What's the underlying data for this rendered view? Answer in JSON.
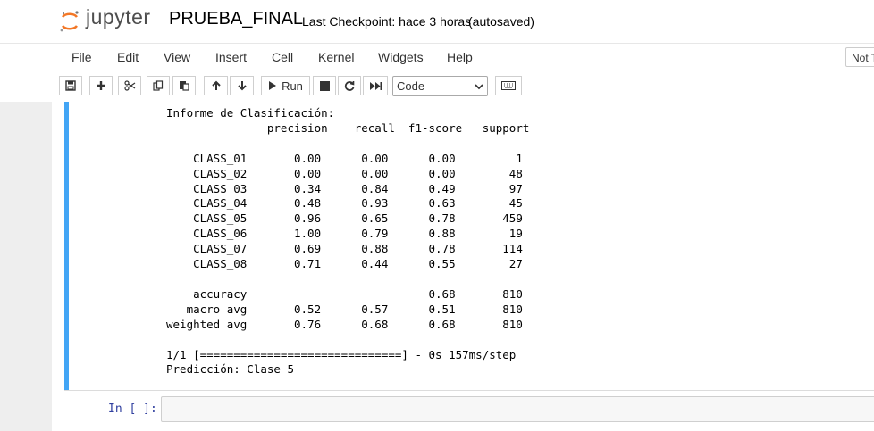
{
  "header": {
    "logo_text": "jupyter",
    "notebook_name": "PRUEBA_FINAL",
    "checkpoint": "Last Checkpoint: hace 3 horas",
    "autosave_status": "(autosaved)"
  },
  "menu": {
    "items": [
      "File",
      "Edit",
      "View",
      "Insert",
      "Cell",
      "Kernel",
      "Widgets",
      "Help"
    ],
    "trusted_label": "Not Trusted"
  },
  "toolbar": {
    "run_label": "Run",
    "cell_type": "Code"
  },
  "output": {
    "lines": [
      "Informe de Clasificación:",
      "               precision    recall  f1-score   support",
      "",
      "    CLASS_01       0.00      0.00      0.00         1",
      "    CLASS_02       0.00      0.00      0.00        48",
      "    CLASS_03       0.34      0.84      0.49        97",
      "    CLASS_04       0.48      0.93      0.63        45",
      "    CLASS_05       0.96      0.65      0.78       459",
      "    CLASS_06       1.00      0.79      0.88        19",
      "    CLASS_07       0.69      0.88      0.78       114",
      "    CLASS_08       0.71      0.44      0.55        27",
      "",
      "    accuracy                           0.68       810",
      "   macro avg       0.52      0.57      0.51       810",
      "weighted avg       0.76      0.68      0.68       810",
      "",
      "1/1 [==============================] - 0s 157ms/step",
      "Predicción: Clase 5"
    ]
  },
  "next_cell": {
    "prompt": "In [ ]:"
  },
  "colors": {
    "selected_cell_bar": "#42a5f5",
    "prompt_color": "#303f9f"
  }
}
